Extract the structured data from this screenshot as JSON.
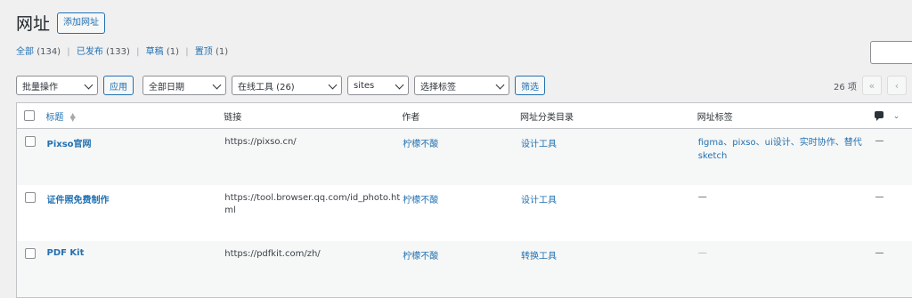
{
  "page": {
    "title": "网址",
    "add_new_label": "添加网址"
  },
  "filters": {
    "all": {
      "label": "全部",
      "count": "(134)"
    },
    "published": {
      "label": "已发布",
      "count": "(133)"
    },
    "draft": {
      "label": "草稿",
      "count": "(1)"
    },
    "sticky": {
      "label": "置顶",
      "count": "(1)"
    }
  },
  "toolbar": {
    "bulk_action": "批量操作",
    "apply_label": "应用",
    "date": "全部日期",
    "category": "在线工具 (26)",
    "type": "sites",
    "tag": "选择标签",
    "filter_label": "筛选",
    "items_count": "26 项",
    "first_page": "«",
    "prev_page": "‹"
  },
  "columns": {
    "title": "标题",
    "link": "链接",
    "author": "作者",
    "category": "网址分类目录",
    "tags": "网址标签"
  },
  "rows": [
    {
      "title": "Pixso官网",
      "url": "https://pixso.cn/",
      "author": "柠檬不酸",
      "category": "设计工具",
      "tags_line1": "figma、pixso、ui设计、实时协作、替代",
      "tags_line2": "sketch",
      "comments": "—"
    },
    {
      "title": "证件照免费制作",
      "url_line1": "https://tool.browser.qq.com/id_photo.ht",
      "url_line2": "ml",
      "author": "柠檬不酸",
      "category": "设计工具",
      "tags": "—",
      "comments": "—"
    },
    {
      "title": "PDF Kit",
      "url": "https://pdfkit.com/zh/",
      "author": "柠檬不酸",
      "category": "转换工具",
      "tags": "—",
      "comments": "—"
    }
  ]
}
